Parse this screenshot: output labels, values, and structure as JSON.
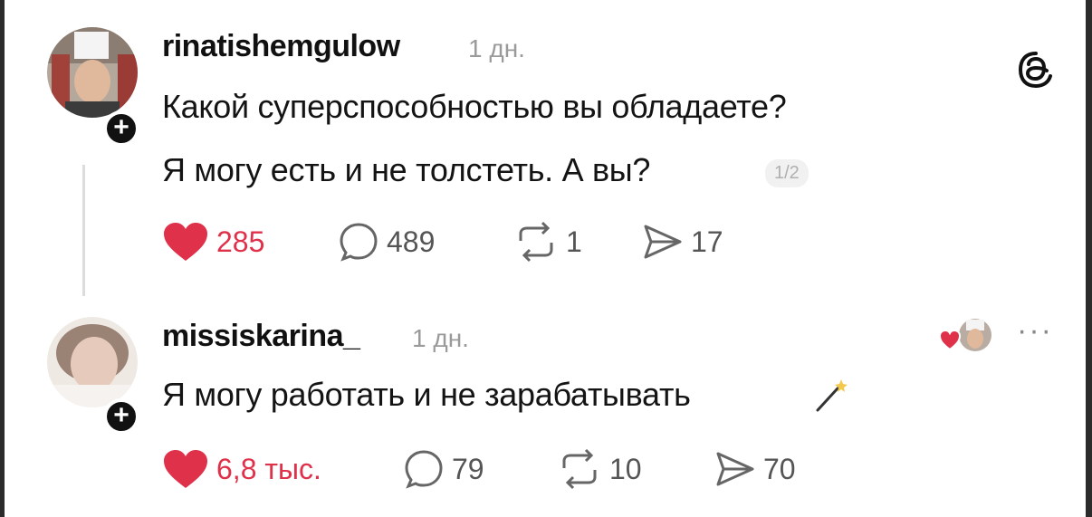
{
  "post1": {
    "username": "rinatishemgulow",
    "time": "1 дн.",
    "line1": "Какой суперспособностью вы обладаете?",
    "line2": "Я могу есть и не толстеть. А вы?",
    "counter": "1/2",
    "likes": "285",
    "replies": "489",
    "reposts": "1",
    "shares": "17"
  },
  "post2": {
    "username": "missiskarina_",
    "time": "1 дн.",
    "text": "Я могу работать и не зарабатывать",
    "likes": "6,8 тыс.",
    "replies": "79",
    "reposts": "10",
    "shares": "70"
  },
  "icons": {
    "threads": "threads-logo-icon",
    "heart": "heart-filled-icon",
    "reply": "speech-bubble-icon",
    "repost": "repost-arrows-icon",
    "share": "send-icon",
    "wand": "magic-wand-icon",
    "more": "more-dots-icon"
  },
  "colors": {
    "heart": "#e0314a",
    "background": "#ffffff",
    "border": "#2b2b2b"
  }
}
